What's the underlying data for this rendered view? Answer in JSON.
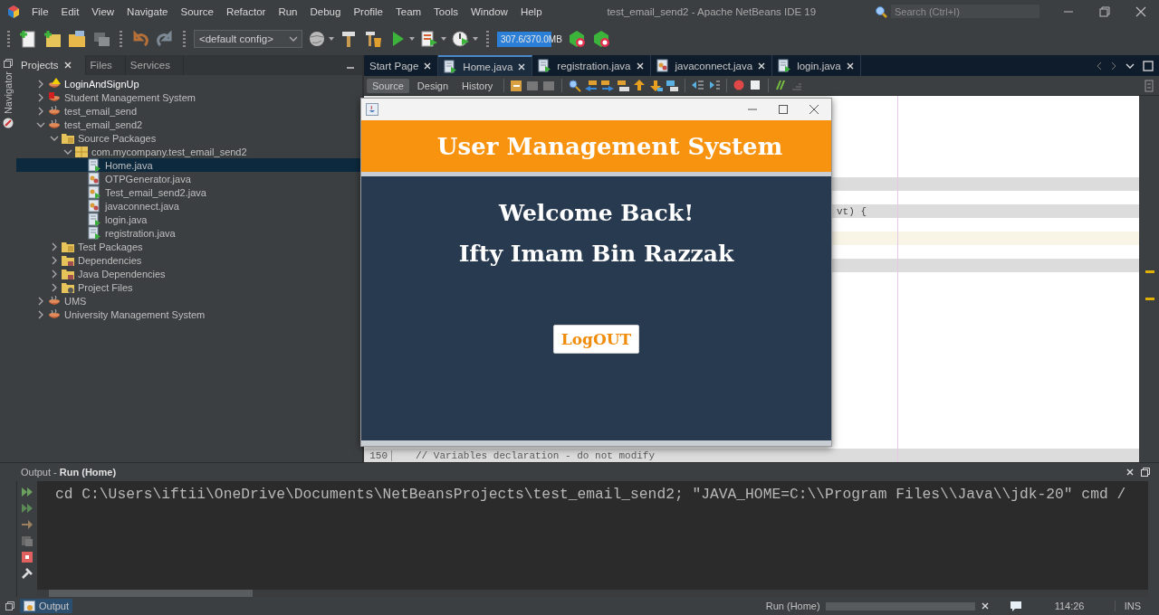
{
  "window": {
    "title": "test_email_send2 - Apache NetBeans IDE 19",
    "search_placeholder": "Search (Ctrl+I)"
  },
  "menu": [
    "File",
    "Edit",
    "View",
    "Navigate",
    "Source",
    "Refactor",
    "Run",
    "Debug",
    "Profile",
    "Team",
    "Tools",
    "Window",
    "Help"
  ],
  "toolbar": {
    "config": "<default config>",
    "memory": {
      "reading": "307.6/370.0MB",
      "level": 0.83
    }
  },
  "side_strip": {
    "label": "Navigator"
  },
  "projects_panel": {
    "tabs": [
      {
        "label": "Projects",
        "selected": true
      },
      {
        "label": "Files",
        "selected": false
      },
      {
        "label": "Services",
        "selected": false
      }
    ],
    "tree": [
      {
        "label": "LoginAndSignUp",
        "kind": "project",
        "main": true,
        "expanded": false,
        "selected": false
      },
      {
        "label": "Student Management System",
        "kind": "project",
        "main": false,
        "expanded": false,
        "selected": false
      },
      {
        "label": "test_email_send",
        "kind": "project",
        "main": false,
        "expanded": false,
        "selected": false
      },
      {
        "label": "test_email_send2",
        "kind": "project",
        "main": false,
        "expanded": true,
        "selected": false,
        "children": [
          {
            "label": "Source Packages",
            "kind": "folder",
            "main": false,
            "expanded": true,
            "selected": false,
            "children": [
              {
                "label": "com.mycompany.test_email_send2",
                "kind": "package",
                "main": false,
                "expanded": true,
                "selected": false,
                "children": [
                  {
                    "label": "Home.java",
                    "kind": "form",
                    "main": false,
                    "selected": true
                  },
                  {
                    "label": "OTPGenerator.java",
                    "kind": "class",
                    "main": false,
                    "selected": false
                  },
                  {
                    "label": "Test_email_send2.java",
                    "kind": "main",
                    "main": false,
                    "selected": false
                  },
                  {
                    "label": "javaconnect.java",
                    "kind": "class",
                    "main": false,
                    "selected": false
                  },
                  {
                    "label": "login.java",
                    "kind": "form",
                    "main": false,
                    "selected": false
                  },
                  {
                    "label": "registration.java",
                    "kind": "form",
                    "main": false,
                    "selected": false
                  }
                ]
              }
            ]
          },
          {
            "label": "Test Packages",
            "kind": "folder",
            "main": false,
            "expanded": false,
            "selected": false
          },
          {
            "label": "Dependencies",
            "kind": "library",
            "main": false,
            "expanded": false,
            "selected": false
          },
          {
            "label": "Java Dependencies",
            "kind": "library",
            "main": false,
            "expanded": false,
            "selected": false
          },
          {
            "label": "Project Files",
            "kind": "files",
            "main": false,
            "expanded": false,
            "selected": false
          }
        ]
      },
      {
        "label": "UMS",
        "kind": "project",
        "main": false,
        "expanded": false,
        "selected": false
      },
      {
        "label": "University Management System",
        "kind": "project",
        "main": false,
        "expanded": false,
        "selected": false
      }
    ]
  },
  "editor": {
    "tabs": [
      {
        "label": "Start Page",
        "selected": false
      },
      {
        "label": "Home.java",
        "kind": "form",
        "selected": true
      },
      {
        "label": "registration.java",
        "kind": "form",
        "selected": false
      },
      {
        "label": "javaconnect.java",
        "kind": "class",
        "selected": false
      },
      {
        "label": "login.java",
        "kind": "form",
        "selected": false
      }
    ],
    "views": [
      {
        "label": "Source",
        "selected": true
      },
      {
        "label": "Design",
        "selected": false
      },
      {
        "label": "History",
        "selected": false
      }
    ],
    "lines": [
      {
        "kind": "plain"
      },
      {
        "kind": "plain"
      },
      {
        "kind": "plain"
      },
      {
        "kind": "plain"
      },
      {
        "kind": "plain"
      },
      {
        "kind": "plain"
      },
      {
        "kind": "guarded"
      },
      {
        "kind": "plain"
      },
      {
        "kind": "guarded",
        "tail": "vt) {"
      },
      {
        "kind": "plain"
      },
      {
        "kind": "current"
      },
      {
        "kind": "plain"
      },
      {
        "kind": "guarded"
      },
      {
        "kind": "plain"
      },
      {
        "kind": "plain"
      },
      {
        "kind": "plain"
      },
      {
        "kind": "plain"
      },
      {
        "kind": "plain"
      },
      {
        "kind": "plain"
      },
      {
        "kind": "plain"
      },
      {
        "kind": "plain"
      },
      {
        "kind": "plain"
      },
      {
        "kind": "plain"
      },
      {
        "kind": "plain"
      },
      {
        "kind": "plain"
      },
      {
        "kind": "plain"
      },
      {
        "kind": "guarded",
        "number": "150",
        "text": "// Variables declaration - do not modify"
      }
    ]
  },
  "dialog": {
    "header": "User Management System",
    "welcome": "Welcome Back!",
    "user_name": "Ifty Imam Bin Razzak",
    "logout_button": "LogOUT"
  },
  "output": {
    "title": "Output - **Run (Home)**",
    "lines": [
      "cd C:\\Users\\iftii\\OneDrive\\Documents\\NetBeansProjects\\test_email_send2; \"JAVA_HOME=C:\\\\Program Files\\\\Java\\\\jdk-20\" cmd /"
    ]
  },
  "status_bar": {
    "output_tab": {
      "label": "Output",
      "selected": true
    },
    "task": "Run (Home)",
    "progress": {
      "level": 1
    },
    "position": "114:26",
    "mode": "INS"
  }
}
